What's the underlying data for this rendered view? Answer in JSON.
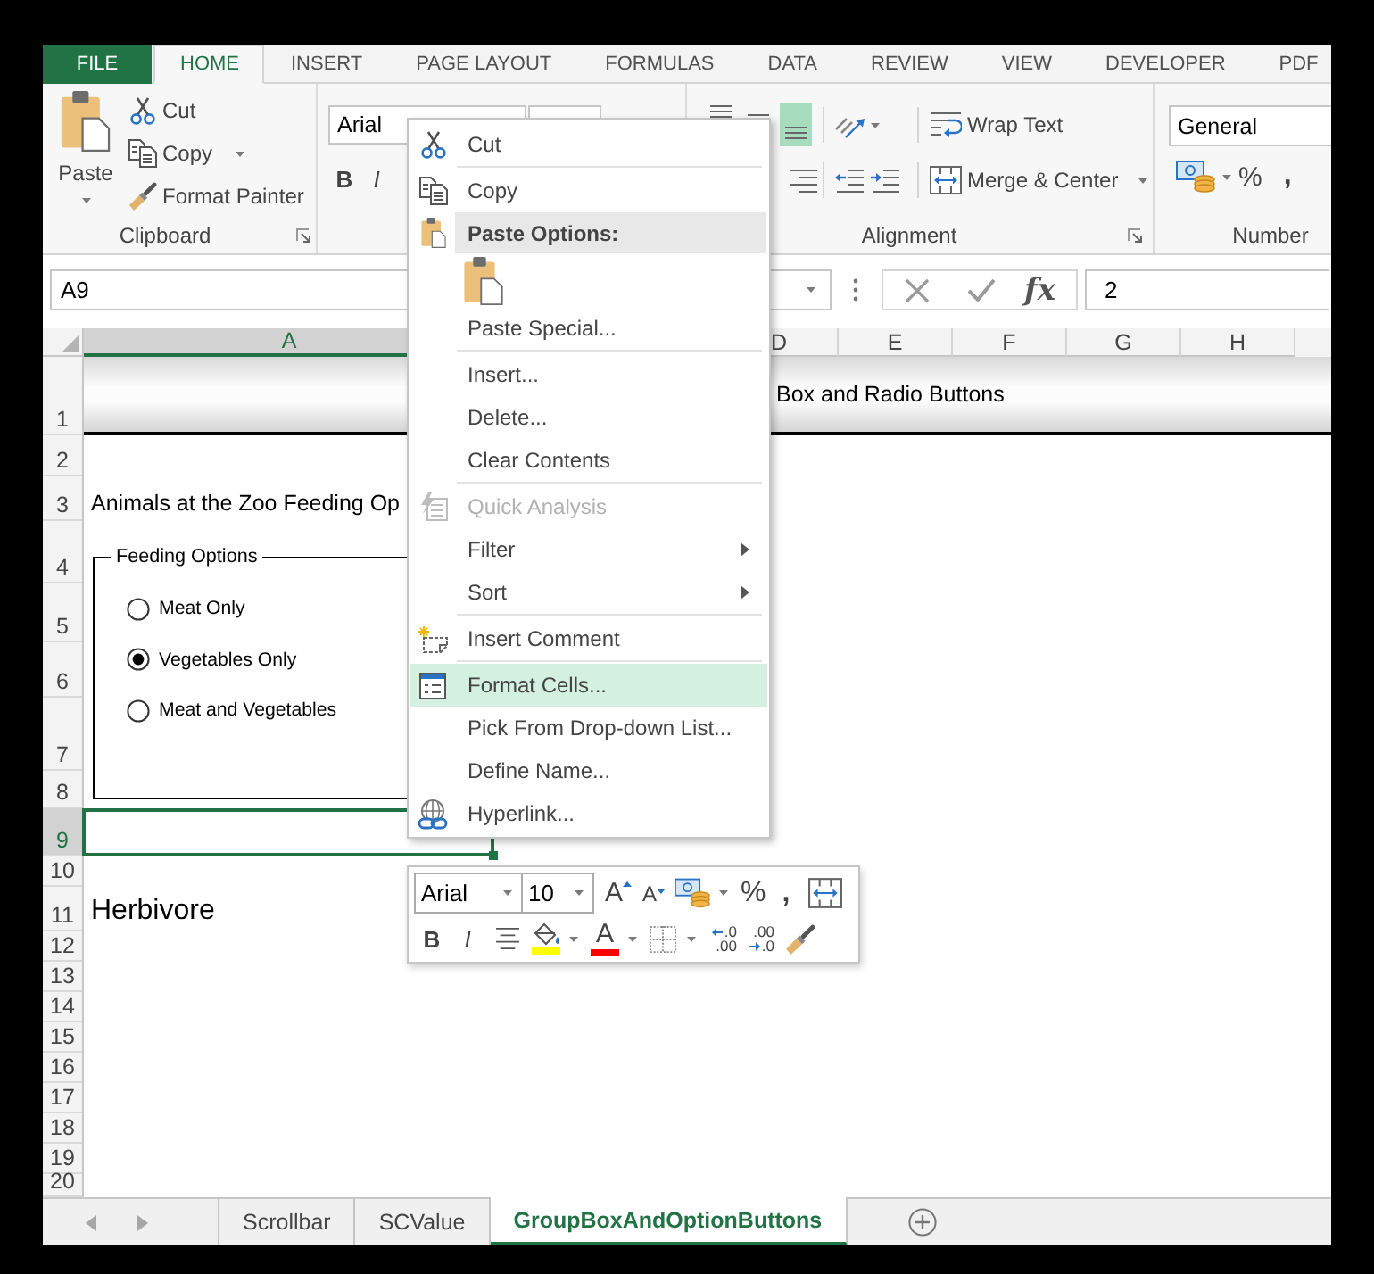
{
  "ribbon_tabs": [
    {
      "label": "FILE",
      "kind": "file",
      "selected": false
    },
    {
      "label": "HOME",
      "kind": "tab",
      "selected": true
    },
    {
      "label": "INSERT",
      "kind": "tab",
      "selected": false
    },
    {
      "label": "PAGE LAYOUT",
      "kind": "tab",
      "selected": false
    },
    {
      "label": "FORMULAS",
      "kind": "tab",
      "selected": false
    },
    {
      "label": "DATA",
      "kind": "tab",
      "selected": false
    },
    {
      "label": "REVIEW",
      "kind": "tab",
      "selected": false
    },
    {
      "label": "VIEW",
      "kind": "tab",
      "selected": false
    },
    {
      "label": "DEVELOPER",
      "kind": "tab",
      "selected": false
    },
    {
      "label": "PDF",
      "kind": "tab",
      "selected": false
    }
  ],
  "ribbon": {
    "clipboard": {
      "paste": "Paste",
      "cut": "Cut",
      "copy": "Copy",
      "format_painter": "Format Painter",
      "label": "Clipboard"
    },
    "font": {
      "font_name": "Arial",
      "bold": "B",
      "italic": "I"
    },
    "alignment": {
      "vertical": [
        {
          "kind": "top",
          "selected": false
        },
        {
          "kind": "middle",
          "selected": false
        },
        {
          "kind": "bottom",
          "selected": true
        }
      ],
      "wrap_text": "Wrap Text",
      "merge_center": "Merge & Center",
      "label": "Alignment"
    },
    "number": {
      "format": "General",
      "percent": "%",
      "comma": ",",
      "label": "Number"
    }
  },
  "formula_bar": {
    "name_box": "A9",
    "function_button": "fx",
    "formula": "2"
  },
  "sheet": {
    "columns": [
      {
        "label": "A",
        "selected": true
      },
      {
        "label": "D",
        "selected": false
      },
      {
        "label": "E",
        "selected": false
      },
      {
        "label": "F",
        "selected": false
      },
      {
        "label": "G",
        "selected": false
      },
      {
        "label": "H",
        "selected": false
      }
    ],
    "rows": [
      {
        "number": "1",
        "selected": false
      },
      {
        "number": "2",
        "selected": false
      },
      {
        "number": "3",
        "selected": false
      },
      {
        "number": "4",
        "selected": false
      },
      {
        "number": "5",
        "selected": false
      },
      {
        "number": "6",
        "selected": false
      },
      {
        "number": "7",
        "selected": false
      },
      {
        "number": "8",
        "selected": false
      },
      {
        "number": "9",
        "selected": true
      },
      {
        "number": "10",
        "selected": false
      },
      {
        "number": "11",
        "selected": false
      },
      {
        "number": "12",
        "selected": false
      },
      {
        "number": "13",
        "selected": false
      },
      {
        "number": "14",
        "selected": false
      },
      {
        "number": "15",
        "selected": false
      },
      {
        "number": "16",
        "selected": false
      },
      {
        "number": "17",
        "selected": false
      },
      {
        "number": "18",
        "selected": false
      },
      {
        "number": "19",
        "selected": false
      },
      {
        "number": "20",
        "selected": false
      }
    ],
    "title": "Box and Radio Buttons",
    "heading": "Animals at the Zoo Feeding Op",
    "result": "Herbivore",
    "group_box": {
      "caption": "Feeding Options",
      "options": [
        {
          "label": "Meat Only",
          "selected": false
        },
        {
          "label": "Vegetables Only",
          "selected": true
        },
        {
          "label": "Meat and Vegetables",
          "selected": false
        }
      ]
    }
  },
  "context_menu": {
    "sections": [
      {
        "items": [
          {
            "kind": "cut",
            "label": "Cut",
            "selected": false,
            "disabled": false
          }
        ]
      },
      {
        "items": [
          {
            "kind": "copy",
            "label": "Copy",
            "selected": false,
            "disabled": false
          },
          {
            "kind": "header",
            "label": "Paste Options:",
            "selected": false,
            "disabled": false
          },
          {
            "kind": "paste",
            "selected": false,
            "disabled": false
          },
          {
            "kind": "plain",
            "label": "Paste Special...",
            "selected": false,
            "disabled": false
          }
        ]
      },
      {
        "items": [
          {
            "kind": "plain",
            "label": "Insert...",
            "selected": false,
            "disabled": false
          },
          {
            "kind": "plain",
            "label": "Delete...",
            "selected": false,
            "disabled": false
          },
          {
            "kind": "plain",
            "label": "Clear Contents",
            "selected": false,
            "disabled": false
          }
        ]
      },
      {
        "items": [
          {
            "kind": "analysis",
            "label": "Quick Analysis",
            "selected": false,
            "disabled": true
          },
          {
            "kind": "submenu",
            "label": "Filter",
            "selected": false,
            "disabled": false
          },
          {
            "kind": "submenu",
            "label": "Sort",
            "selected": false,
            "disabled": false
          }
        ]
      },
      {
        "items": [
          {
            "kind": "comment",
            "label": "Insert Comment",
            "selected": false,
            "disabled": false
          }
        ]
      },
      {
        "items": [
          {
            "kind": "format",
            "label": "Format Cells...",
            "selected": true,
            "disabled": false
          },
          {
            "kind": "plain",
            "label": "Pick From Drop-down List...",
            "selected": false,
            "disabled": false
          },
          {
            "kind": "plain",
            "label": "Define Name...",
            "selected": false,
            "disabled": false
          },
          {
            "kind": "link",
            "label": "Hyperlink...",
            "selected": false,
            "disabled": false
          }
        ]
      }
    ]
  },
  "mini_toolbar": {
    "font_name": "Arial",
    "font_size": "10",
    "upper_buttons": [
      {
        "kind": "grow",
        "text": "A"
      },
      {
        "kind": "shrink",
        "text": "A"
      },
      {
        "kind": "money"
      },
      {
        "kind": "percent",
        "text": "%"
      },
      {
        "kind": "comma",
        "text": ","
      },
      {
        "kind": "merge"
      }
    ],
    "lower_buttons": [
      {
        "kind": "bold",
        "text": "B"
      },
      {
        "kind": "italic",
        "text": "I"
      },
      {
        "kind": "center"
      },
      {
        "kind": "fill",
        "color": "#ffff00"
      },
      {
        "kind": "font_color",
        "text": "A",
        "color": "#ff0000"
      },
      {
        "kind": "borders"
      },
      {
        "kind": "add_decimal",
        "text": ".0",
        "subtext": ".00"
      },
      {
        "kind": "remove_decimal",
        "text": ".00",
        "subtext": ".0"
      },
      {
        "kind": "painter"
      }
    ]
  },
  "sheet_tabs": [
    {
      "label": "Scrollbar",
      "selected": false
    },
    {
      "label": "SCValue",
      "selected": false
    },
    {
      "label": "GroupBoxAndOptionButtons",
      "selected": true
    }
  ]
}
